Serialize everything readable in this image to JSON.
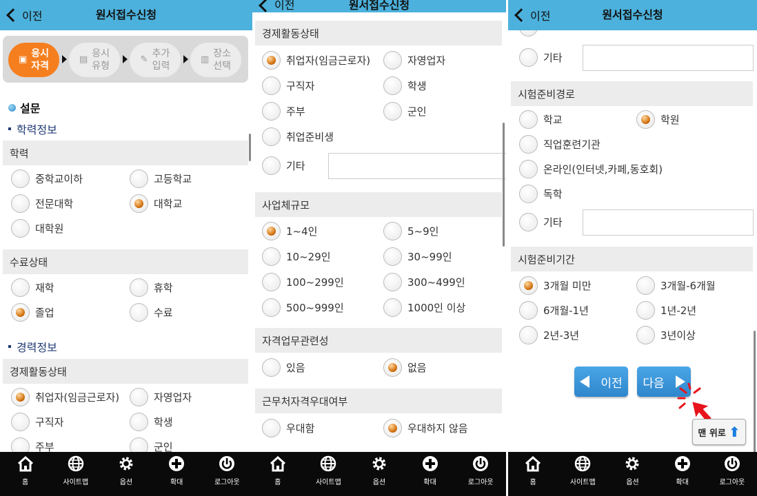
{
  "header": {
    "back_label": "이전",
    "title": "원서접수신청"
  },
  "footer": [
    {
      "label": "홈",
      "icon": "home-icon"
    },
    {
      "label": "사이트맵",
      "icon": "globe-icon"
    },
    {
      "label": "옵션",
      "icon": "gear-icon"
    },
    {
      "label": "확대",
      "icon": "plus-icon"
    },
    {
      "label": "로그아웃",
      "icon": "power-icon"
    }
  ],
  "steps": [
    {
      "label": "응시\n자격",
      "active": true
    },
    {
      "label": "응시\n유형",
      "active": false
    },
    {
      "label": "추가\n입력",
      "active": false
    },
    {
      "label": "장소\n선택",
      "active": false
    }
  ],
  "panel1": {
    "survey_title": "설문",
    "education_title": "학력정보",
    "education": {
      "title": "학력",
      "options": [
        "중학교이하",
        "고등학교",
        "전문대학",
        "대학교",
        "대학원"
      ],
      "selected": "대학교"
    },
    "completion": {
      "title": "수료상태",
      "options": [
        "재학",
        "휴학",
        "졸업",
        "수료"
      ],
      "selected": "졸업"
    },
    "career_title": "경력정보",
    "economic": {
      "title": "경제활동상태",
      "options": [
        "취업자(임금근로자)",
        "자영업자",
        "구직자",
        "학생",
        "주부",
        "군인"
      ],
      "selected": "취업자(임금근로자)"
    }
  },
  "panel2": {
    "economic": {
      "title": "경제활동상태",
      "options": [
        "취업자(임금근로자)",
        "자영업자",
        "구직자",
        "학생",
        "주부",
        "군인",
        "취업준비생",
        "기타"
      ],
      "selected": "취업자(임금근로자)"
    },
    "company_size": {
      "title": "사업체규모",
      "options": [
        "1~4인",
        "5~9인",
        "10~29인",
        "30~99인",
        "100~299인",
        "300~499인",
        "500~999인",
        "1000인 이상"
      ],
      "selected": "1~4인"
    },
    "relevance": {
      "title": "자격업무관련성",
      "options": [
        "있음",
        "없음"
      ],
      "selected": "없음"
    },
    "preference": {
      "title": "근무처자격우대여부",
      "options": [
        "우대함",
        "우대하지 않음"
      ],
      "selected": "우대하지 않음"
    }
  },
  "panel3": {
    "other_label": "기타",
    "prep_route": {
      "title": "시험준비경로",
      "options": [
        "학교",
        "학원",
        "직업훈련기관",
        "온라인(인터넷,카페,동호회)",
        "독학",
        "기타"
      ],
      "selected": "학원"
    },
    "prep_period": {
      "title": "시험준비기간",
      "options": [
        "3개월 미만",
        "3개월-6개월",
        "6개월-1년",
        "1년-2년",
        "2년-3년",
        "3년이상"
      ],
      "selected": "3개월 미만"
    },
    "prev_button": "이전",
    "next_button": "다음",
    "top_button": "맨 위로"
  }
}
